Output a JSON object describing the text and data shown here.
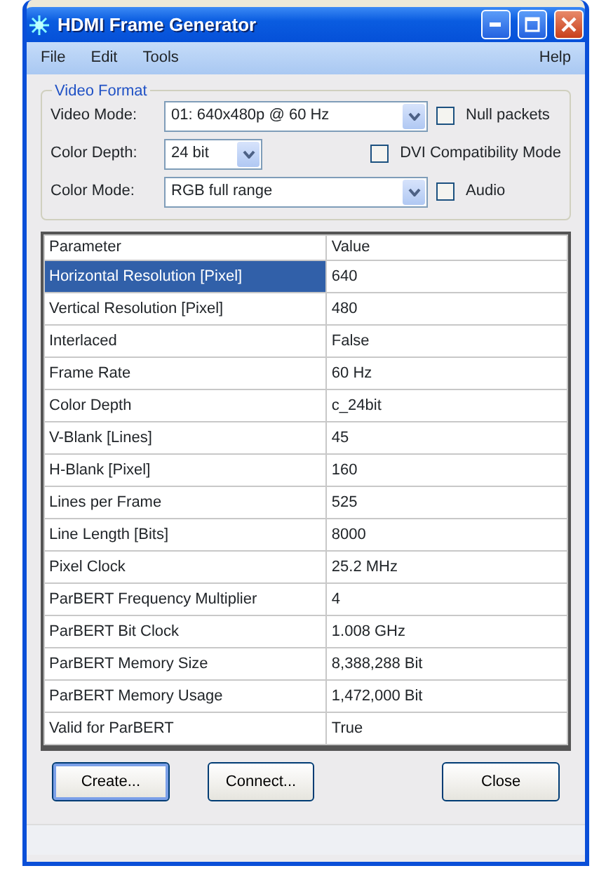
{
  "window": {
    "title": "HDMI Frame Generator"
  },
  "menu": {
    "left": [
      "File",
      "Edit",
      "Tools"
    ],
    "right": [
      "Help"
    ]
  },
  "video_format": {
    "title": "Video Format",
    "video_mode": {
      "label": "Video Mode:",
      "value": "01: 640x480p @ 60 Hz"
    },
    "null_packets": {
      "label": "Null packets",
      "checked": false
    },
    "color_depth": {
      "label": "Color Depth:",
      "value": "24 bit"
    },
    "dvi_mode": {
      "label": "DVI Compatibility Mode",
      "checked": false
    },
    "color_mode": {
      "label": "Color Mode:",
      "value": "RGB full range"
    },
    "audio": {
      "label": "Audio",
      "checked": false
    }
  },
  "table": {
    "columns": [
      "Parameter",
      "Value"
    ],
    "rows": [
      {
        "cells": [
          "Horizontal Resolution [Pixel]",
          "640"
        ],
        "selected": true
      },
      {
        "cells": [
          "Vertical Resolution [Pixel]",
          "480"
        ],
        "selected": false
      },
      {
        "cells": [
          "Interlaced",
          "False"
        ],
        "selected": false
      },
      {
        "cells": [
          "Frame Rate",
          "60 Hz"
        ],
        "selected": false
      },
      {
        "cells": [
          "Color Depth",
          "c_24bit"
        ],
        "selected": false
      },
      {
        "cells": [
          "V-Blank [Lines]",
          "45"
        ],
        "selected": false
      },
      {
        "cells": [
          "H-Blank [Pixel]",
          "160"
        ],
        "selected": false
      },
      {
        "cells": [
          "Lines per Frame",
          "525"
        ],
        "selected": false
      },
      {
        "cells": [
          "Line Length [Bits]",
          "8000"
        ],
        "selected": false
      },
      {
        "cells": [
          "Pixel Clock",
          "25.2 MHz"
        ],
        "selected": false
      },
      {
        "cells": [
          "ParBERT Frequency Multiplier",
          "4"
        ],
        "selected": false
      },
      {
        "cells": [
          "ParBERT Bit Clock",
          "1.008 GHz"
        ],
        "selected": false
      },
      {
        "cells": [
          "ParBERT Memory Size",
          "8,388,288 Bit"
        ],
        "selected": false
      },
      {
        "cells": [
          "ParBERT Memory Usage",
          "1,472,000 Bit"
        ],
        "selected": false
      },
      {
        "cells": [
          "Valid for ParBERT",
          "True"
        ],
        "selected": false
      }
    ]
  },
  "buttons": [
    {
      "label": "Create...",
      "default": true
    },
    {
      "label": "Connect...",
      "default": false
    },
    {
      "label": "Close",
      "default": false
    }
  ]
}
